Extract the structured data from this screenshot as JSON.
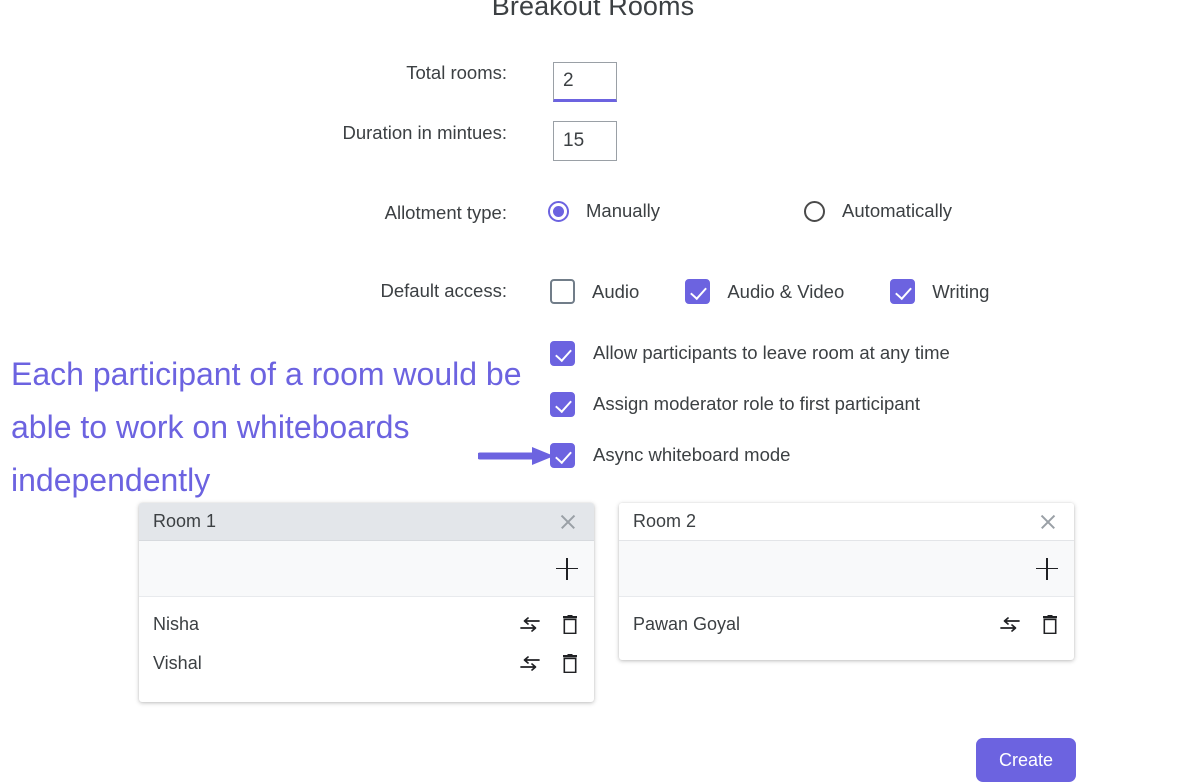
{
  "header": {
    "title": "Breakout Rooms"
  },
  "colors": {
    "accent": "#6C63E0",
    "text": "#3c4043",
    "card_header": "#e3e6ea"
  },
  "form": {
    "total_rooms": {
      "label": "Total rooms:",
      "value": "2"
    },
    "duration": {
      "label": "Duration in mintues:",
      "value": "15"
    },
    "allotment": {
      "label": "Allotment type:",
      "options": [
        {
          "label": "Manually",
          "selected": true
        },
        {
          "label": "Automatically",
          "selected": false
        }
      ]
    },
    "default_access": {
      "label": "Default access:",
      "options": [
        {
          "label": "Audio",
          "checked": false
        },
        {
          "label": "Audio & Video",
          "checked": true
        },
        {
          "label": "Writing",
          "checked": true
        }
      ]
    },
    "options": [
      {
        "label": "Allow participants to leave room at any time",
        "checked": true
      },
      {
        "label": "Assign moderator role to first participant",
        "checked": true
      },
      {
        "label": "Async whiteboard mode",
        "checked": true
      }
    ]
  },
  "annotation": {
    "text": "Each participant of a room would be able to work on whiteboards independently"
  },
  "rooms": [
    {
      "title": "Room 1",
      "close_icon": "close-icon",
      "add_icon": "plus-icon",
      "participants": [
        {
          "name": "Nisha",
          "swap_icon": "swap-icon",
          "delete_icon": "trash-icon"
        },
        {
          "name": "Vishal",
          "swap_icon": "swap-icon",
          "delete_icon": "trash-icon"
        }
      ]
    },
    {
      "title": "Room 2",
      "close_icon": "close-icon",
      "add_icon": "plus-icon",
      "participants": [
        {
          "name": "Pawan Goyal",
          "swap_icon": "swap-icon",
          "delete_icon": "trash-icon"
        }
      ]
    }
  ],
  "footer": {
    "create_label": "Create"
  }
}
